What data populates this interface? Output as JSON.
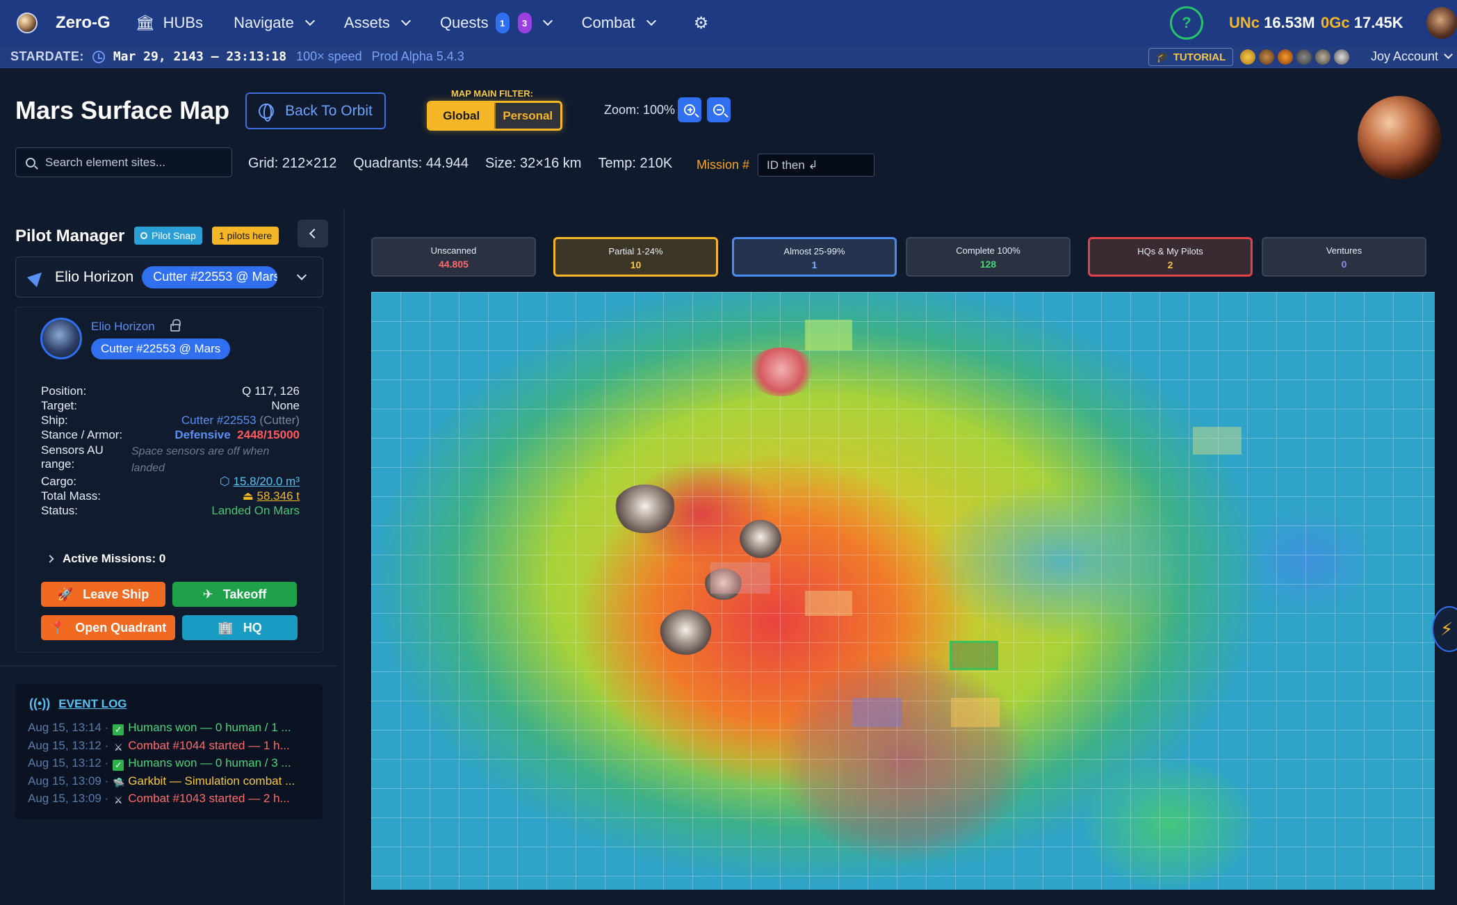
{
  "nav": {
    "brand": "Zero-G",
    "items": [
      {
        "label": "HUBs"
      },
      {
        "label": "Navigate"
      },
      {
        "label": "Assets"
      },
      {
        "label": "Quests",
        "badges": [
          "1",
          "3"
        ]
      },
      {
        "label": "Combat"
      }
    ],
    "help_symbol": "?",
    "currency": [
      {
        "label": "UNc",
        "value": "16.53M"
      },
      {
        "label": "0Gc",
        "value": "17.45K"
      }
    ]
  },
  "stardate": {
    "label": "STARDATE:",
    "datetime": "Mar 29, 2143 — 23:13:18",
    "speed": "100× speed",
    "version": "Prod Alpha 5.4.3",
    "tutorial": "TUTORIAL",
    "account": "Joy Account"
  },
  "header": {
    "title": "Mars Surface Map",
    "back_button": "Back To Orbit",
    "filter_label": "MAP MAIN FILTER:",
    "filter_options": [
      "Global",
      "Personal"
    ],
    "filter_selected": "Global",
    "zoom_label": "Zoom: 100%",
    "search_placeholder": "Search element sites...",
    "stats": [
      "Grid: 212×212",
      "Quadrants: 44.944",
      "Size: 32×16 km",
      "Temp: 210K"
    ],
    "mission_label": "Mission #",
    "mission_placeholder": "ID then ↲"
  },
  "pilot_manager": {
    "title": "Pilot Manager",
    "badge_snap": "Pilot Snap",
    "badge_here": "1 pilots here",
    "selected_pilot": "Elio Horizon",
    "selected_ship": "Cutter #22553 @ Mars",
    "card": {
      "name": "Elio Horizon",
      "ship_chip": "Cutter #22553 @ Mars",
      "fields": {
        "position_label": "Position:",
        "position": "Q 117, 126",
        "target_label": "Target:",
        "target": "None",
        "ship_label": "Ship:",
        "ship": "Cutter #22553",
        "ship_type": "(Cutter)",
        "stance_label": "Stance / Armor:",
        "stance": "Defensive",
        "armor": "2448/15000",
        "sensors_label_1": "Sensors AU",
        "sensors_label_2": "range:",
        "sensors": "Space sensors are off when landed",
        "cargo_label": "Cargo:",
        "cargo": "15.8/20.0 m³",
        "mass_label": "Total Mass:",
        "mass": "58.346 t",
        "status_label": "Status:",
        "status": "Landed On Mars"
      },
      "active_missions": "Active Missions: 0",
      "buttons": {
        "leave_ship": "Leave Ship",
        "takeoff": "Takeoff",
        "open_quadrant": "Open Quadrant",
        "hq": "HQ"
      }
    }
  },
  "event_log": {
    "title": "EVENT LOG",
    "entries": [
      {
        "time": "Aug 15, 13:14 ·",
        "text": "Humans won — 0 human / 1 ..."
      },
      {
        "time": "Aug 15, 13:12 ·",
        "text": "Combat #1044 started — 1 h..."
      },
      {
        "time": "Aug 15, 13:12 ·",
        "text": "Humans won — 0 human / 3 ..."
      },
      {
        "time": "Aug 15, 13:09 ·",
        "text": "Garkbit — Simulation combat ..."
      },
      {
        "time": "Aug 15, 13:09 ·",
        "text": "Combat #1043 started — 2 h..."
      }
    ]
  },
  "scan_filters": [
    {
      "label": "Unscanned",
      "value": "44.805"
    },
    {
      "label": "Partial 1-24%",
      "value": "10"
    },
    {
      "label": "Almost 25-99%",
      "value": "1"
    },
    {
      "label": "Complete 100%",
      "value": "128"
    },
    {
      "label": "HQs & My Pilots",
      "value": "2"
    },
    {
      "label": "Ventures",
      "value": "0"
    }
  ],
  "map": {
    "name": "mars-elevation-map"
  },
  "colors": {
    "nav_bg": "#1d3a82",
    "accent_blue": "#2f6ff0",
    "accent_yellow": "#f5b628",
    "accent_orange": "#f06a22",
    "accent_green": "#1fa14a",
    "accent_teal": "#1a9bc4"
  }
}
